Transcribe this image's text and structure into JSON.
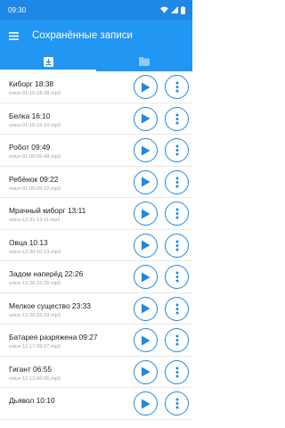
{
  "status_bar": {
    "time": "09:30",
    "icons": [
      "wifi-icon",
      "signal-icon",
      "battery-icon"
    ]
  },
  "toolbar": {
    "title": "Сохранённые записи",
    "menu_icon": "menu-icon"
  },
  "tabs": [
    {
      "name": "download-tab",
      "icon": "download-icon",
      "selected": true
    },
    {
      "name": "folder-tab",
      "icon": "folder-icon",
      "selected": false
    }
  ],
  "colors": {
    "status_bar": "#1e88e5",
    "toolbar": "#2196f3",
    "accent": "#1e88e5",
    "title_text": "#212121",
    "subtitle_text": "#9e9e9e"
  },
  "recordings": [
    {
      "title": "Киборг 18:38",
      "file": "voice-01-15-18-38.mp3"
    },
    {
      "title": "Белка 16:10",
      "file": "voice-01-10-16-10.mp3"
    },
    {
      "title": "Робот 09:49",
      "file": "voice-01-06-09-49.mp3"
    },
    {
      "title": "Ребёнок 09:22",
      "file": "voice-01-05-09-22.mp3"
    },
    {
      "title": "Мрачный киборг 13:11",
      "file": "voice-12-31-13-11.mp3"
    },
    {
      "title": "Овца 10:13",
      "file": "voice-12-30-10-13.mp3"
    },
    {
      "title": "Задом наперёд 22:26",
      "file": "voice-12-26-22-26.mp3"
    },
    {
      "title": "Мелкое существо 23:33",
      "file": "voice-12-20-23-33.mp3"
    },
    {
      "title": "Батарея разряжена 09:27",
      "file": "voice-12-17-09-27.mp3"
    },
    {
      "title": "Гигант 06:55",
      "file": "voice-12-13-06-55.mp3"
    },
    {
      "title": "Дьявол 10:10",
      "file": ""
    }
  ]
}
